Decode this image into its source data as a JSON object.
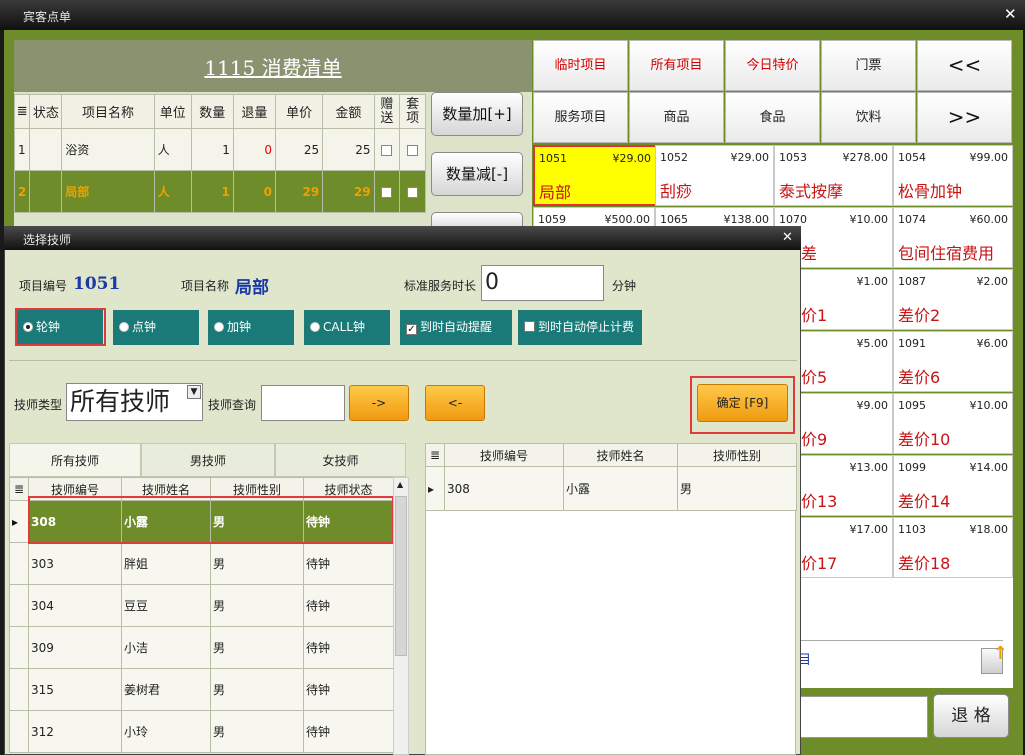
{
  "main": {
    "title": "宾客点单"
  },
  "bill": {
    "title": "1115  消费清单",
    "columns": [
      "状态",
      "项目名称",
      "单位",
      "数量",
      "退量",
      "单价",
      "金额",
      "赠送",
      "套项"
    ],
    "rows": [
      {
        "no": "1",
        "status": "",
        "name": "浴资",
        "unit": "人",
        "qty": "1",
        "ret": "0",
        "price": "25",
        "amount": "25"
      },
      {
        "no": "2",
        "status": "",
        "name": "局部",
        "unit": "人",
        "qty": "1",
        "ret": "0",
        "price": "29",
        "amount": "29"
      }
    ]
  },
  "buttons": {
    "qty_add": "数量加[+]",
    "qty_sub": "数量减[-]",
    "exit": "退 格"
  },
  "categories": [
    {
      "label": "临时项目"
    },
    {
      "label": "所有项目"
    },
    {
      "label": "今日特价"
    },
    {
      "label": "门票"
    },
    {
      "label": "<<"
    },
    {
      "label": "服务项目"
    },
    {
      "label": "商品"
    },
    {
      "label": "食品"
    },
    {
      "label": "饮料"
    },
    {
      "label": ">>"
    }
  ],
  "tiles": [
    {
      "code": "1051",
      "price": "¥29.00",
      "name": "局部"
    },
    {
      "code": "1052",
      "price": "¥29.00",
      "name": "刮痧"
    },
    {
      "code": "1053",
      "price": "¥278.00",
      "name": "泰式按摩"
    },
    {
      "code": "1054",
      "price": "¥99.00",
      "name": "松骨加钟"
    },
    {
      "code": "1059",
      "price": "¥500.00",
      "name": ""
    },
    {
      "code": "1065",
      "price": "¥138.00",
      "name": ""
    },
    {
      "code": "1070",
      "price": "¥10.00",
      "name": "差"
    },
    {
      "code": "1074",
      "price": "¥60.00",
      "name": "包间住宿费用"
    },
    {
      "code": "",
      "price": "¥1.00",
      "name": "价1"
    },
    {
      "code": "1087",
      "price": "¥2.00",
      "name": "差价2"
    },
    {
      "code": "",
      "price": "¥5.00",
      "name": "价5"
    },
    {
      "code": "1091",
      "price": "¥6.00",
      "name": "差价6"
    },
    {
      "code": "",
      "price": "¥9.00",
      "name": "价9"
    },
    {
      "code": "1095",
      "price": "¥10.00",
      "name": "差价10"
    },
    {
      "code": "",
      "price": "¥13.00",
      "name": "价13"
    },
    {
      "code": "1099",
      "price": "¥14.00",
      "name": "差价14"
    },
    {
      "code": "",
      "price": "¥17.00",
      "name": "价17"
    },
    {
      "code": "1103",
      "price": "¥18.00",
      "name": "差价18"
    }
  ],
  "status_fragment": "目",
  "dialog": {
    "title": "选择技师",
    "item_code_label": "项目编号",
    "item_code": "1051",
    "item_name_label": "项目名称",
    "item_name": "局部",
    "std_time_label": "标准服务时长",
    "std_time_value": "0",
    "minutes_label": "分钟",
    "radios": [
      "轮钟",
      "点钟",
      "加钟",
      "CALL钟"
    ],
    "checks": [
      "到时自动提醒",
      "到时自动停止计费"
    ],
    "tech_type_label": "技师类型",
    "tech_type_value": "所有技师",
    "tech_search_label": "技师查询",
    "arrow_right": "->",
    "arrow_left": "<-",
    "confirm": "确定 [F9]",
    "tabs": [
      "所有技师",
      "男技师",
      "女技师"
    ],
    "tech_columns": [
      "技师编号",
      "技师姓名",
      "技师性别",
      "技师状态"
    ],
    "techs": [
      {
        "id": "308",
        "name": "小露",
        "sex": "男",
        "state": "待钟"
      },
      {
        "id": "303",
        "name": "胖姐",
        "sex": "男",
        "state": "待钟"
      },
      {
        "id": "304",
        "name": "豆豆",
        "sex": "男",
        "state": "待钟"
      },
      {
        "id": "309",
        "name": "小洁",
        "sex": "男",
        "state": "待钟"
      },
      {
        "id": "315",
        "name": "姜树君",
        "sex": "男",
        "state": "待钟"
      },
      {
        "id": "312",
        "name": "小玲",
        "sex": "男",
        "state": "待钟"
      }
    ],
    "chosen_columns": [
      "技师编号",
      "技师姓名",
      "技师性别"
    ],
    "chosen": [
      {
        "id": "308",
        "name": "小露",
        "sex": "男"
      }
    ]
  }
}
